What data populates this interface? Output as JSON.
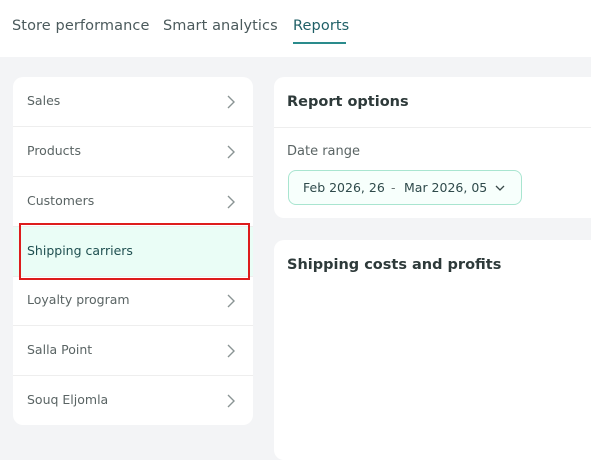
{
  "tabs": [
    {
      "label": "Store performance"
    },
    {
      "label": "Smart analytics"
    },
    {
      "label": "Reports"
    }
  ],
  "sidebar": {
    "items": [
      {
        "label": "Sales"
      },
      {
        "label": "Products"
      },
      {
        "label": "Customers"
      },
      {
        "label": "Shipping carriers"
      },
      {
        "label": "Loyalty program"
      },
      {
        "label": "Salla Point"
      },
      {
        "label": "Souq Eljomla"
      }
    ]
  },
  "report_options": {
    "title": "Report options",
    "date_range_label": "Date range",
    "date_from": "Feb 2026, 26",
    "separator": "-",
    "date_to": "Mar 2026, 05"
  },
  "shipping_card": {
    "title": "Shipping costs and profits"
  },
  "colors": {
    "accent": "#2a8b8c",
    "active_bg": "#eafdf6",
    "highlight": "#dd1c1c"
  }
}
